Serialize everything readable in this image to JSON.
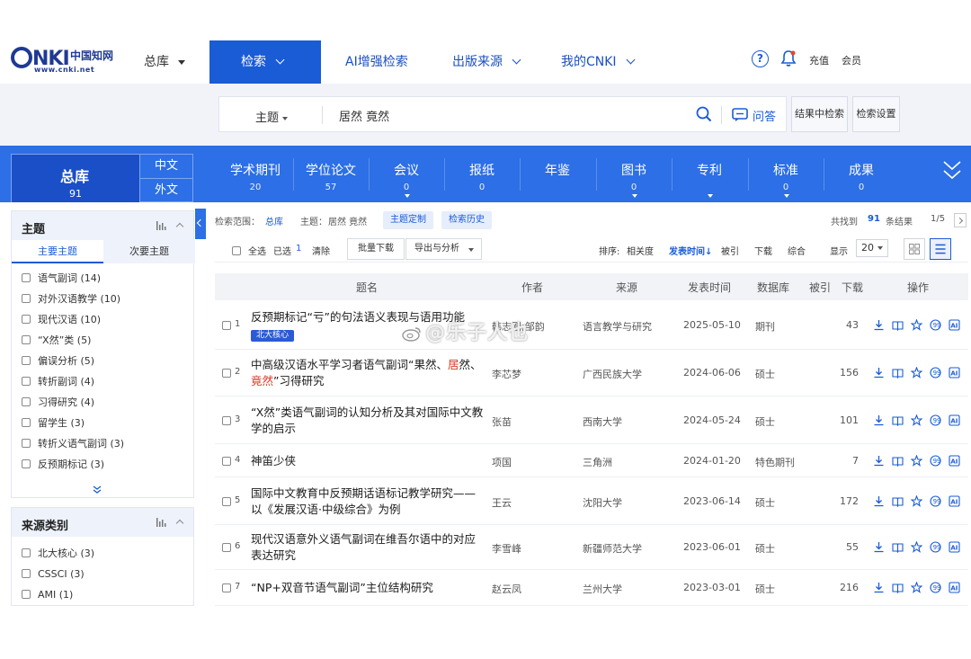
{
  "header": {
    "logo_cn": "中国知网",
    "logo_url": "www.cnki.net",
    "database_label": "总库",
    "nav": [
      {
        "label": "检索",
        "active": true
      },
      {
        "label": "AI增强检索"
      },
      {
        "label": "出版来源"
      },
      {
        "label": "我的CNKI"
      }
    ],
    "recharge": "充值",
    "member": "会员"
  },
  "search": {
    "field": "主题",
    "query": "居然 竟然",
    "qa_label": "问答",
    "within_results": "结果中检索",
    "settings": "检索设置"
  },
  "categories": {
    "all_label": "总库",
    "all_count": "91",
    "lang_cn": "中文",
    "lang_en": "外文",
    "items": [
      {
        "label": "学术期刊",
        "count": "20"
      },
      {
        "label": "学位论文",
        "count": "57"
      },
      {
        "label": "会议",
        "count": "0"
      },
      {
        "label": "报纸",
        "count": "0"
      },
      {
        "label": "年鉴",
        "count": ""
      },
      {
        "label": "图书",
        "count": "0"
      },
      {
        "label": "专利",
        "count": ""
      },
      {
        "label": "标准",
        "count": "0"
      },
      {
        "label": "成果",
        "count": "0"
      }
    ]
  },
  "sidebar": {
    "topic": {
      "title": "主题",
      "tab_main": "主要主题",
      "tab_secondary": "次要主题",
      "items": [
        {
          "label": "语气副词",
          "count": "(14)"
        },
        {
          "label": "对外汉语教学",
          "count": "(10)"
        },
        {
          "label": "现代汉语",
          "count": "(10)"
        },
        {
          "label": "“X然”类",
          "count": "(5)"
        },
        {
          "label": "偏误分析",
          "count": "(5)"
        },
        {
          "label": "转折副词",
          "count": "(4)"
        },
        {
          "label": "习得研究",
          "count": "(4)"
        },
        {
          "label": "留学生",
          "count": "(3)"
        },
        {
          "label": "转折义语气副词",
          "count": "(3)"
        },
        {
          "label": "反预期标记",
          "count": "(3)"
        }
      ]
    },
    "source": {
      "title": "来源类别",
      "items": [
        {
          "label": "北大核心",
          "count": "(3)"
        },
        {
          "label": "CSSCI",
          "count": "(3)"
        },
        {
          "label": "AMI",
          "count": "(1)"
        }
      ]
    }
  },
  "results": {
    "scope_label": "检索范围：",
    "scope_value": "总库",
    "topic_label": "主题：",
    "topic_value": "居然 竟然",
    "topic_custom": "主题定制",
    "history": "检索历史",
    "found_prefix": "共找到",
    "found_count": "91",
    "found_suffix": "条结果",
    "page": "1/5",
    "select_all": "全选",
    "selected_label": "已选",
    "selected_count": "1",
    "clear": "清除",
    "batch_download": "批量下载",
    "export_analyze": "导出与分析",
    "sort_label": "排序:",
    "sort_options": [
      "相关度",
      "发表时间",
      "被引",
      "下载",
      "综合"
    ],
    "display_label": "显示",
    "page_size": "20",
    "columns": [
      "题名",
      "作者",
      "来源",
      "发表时间",
      "数据库",
      "被引",
      "下载",
      "操作"
    ],
    "rows": [
      {
        "num": "1",
        "title_parts": [
          {
            "t": "反预期标记“亏”的句法语义表现与语用功能",
            "hl": false
          }
        ],
        "badge": "北大核心",
        "author": "韩志刚;邹韵",
        "source": "语言教学与研究",
        "date": "2025-05-10",
        "db": "期刊",
        "cited": "",
        "downloads": "43"
      },
      {
        "num": "2",
        "title_parts": [
          {
            "t": "中高级汉语水平学习者语气副词“果然、",
            "hl": false
          },
          {
            "t": "居",
            "hl": true
          },
          {
            "t": "然、",
            "hl": false
          },
          {
            "t": "竟然",
            "hl": true
          },
          {
            "t": "”习得研究",
            "hl": false
          }
        ],
        "badge": "",
        "author": "李芯梦",
        "source": "广西民族大学",
        "date": "2024-06-06",
        "db": "硕士",
        "cited": "",
        "downloads": "156"
      },
      {
        "num": "3",
        "title_parts": [
          {
            "t": "“X然”类语气副词的认知分析及其对国际中文教学的启示",
            "hl": false
          }
        ],
        "badge": "",
        "author": "张苗",
        "source": "西南大学",
        "date": "2024-05-24",
        "db": "硕士",
        "cited": "",
        "downloads": "101"
      },
      {
        "num": "4",
        "title_parts": [
          {
            "t": "神笛少侠",
            "hl": false
          }
        ],
        "badge": "",
        "author": "项国",
        "source": "三角洲",
        "date": "2024-01-20",
        "db": "特色期刊",
        "cited": "",
        "downloads": "7"
      },
      {
        "num": "5",
        "title_parts": [
          {
            "t": "国际中文教育中反预期话语标记教学研究——以《发展汉语·中级综合》为例",
            "hl": false
          }
        ],
        "badge": "",
        "author": "王云",
        "source": "沈阳大学",
        "date": "2023-06-14",
        "db": "硕士",
        "cited": "",
        "downloads": "172"
      },
      {
        "num": "6",
        "title_parts": [
          {
            "t": "现代汉语意外义语气副词在维吾尔语中的对应表达研究",
            "hl": false
          }
        ],
        "badge": "",
        "author": "李雪峰",
        "source": "新疆师范大学",
        "date": "2023-06-01",
        "db": "硕士",
        "cited": "",
        "downloads": "55"
      },
      {
        "num": "7",
        "title_parts": [
          {
            "t": "“NP+双音节语气副词”主位结构研究",
            "hl": false
          }
        ],
        "badge": "",
        "author": "赵云凤",
        "source": "兰州大学",
        "date": "2023-03-01",
        "db": "硕士",
        "cited": "",
        "downloads": "216"
      }
    ],
    "row_actions": [
      "download-icon",
      "read-icon",
      "favorite-icon",
      "quote-icon",
      "ai-icon"
    ]
  },
  "watermark": "@乐子人也",
  "colors": {
    "brand_blue": "#1a5bd6",
    "band_blue": "#2c6fe6",
    "highlight_red": "#d63b2a"
  }
}
